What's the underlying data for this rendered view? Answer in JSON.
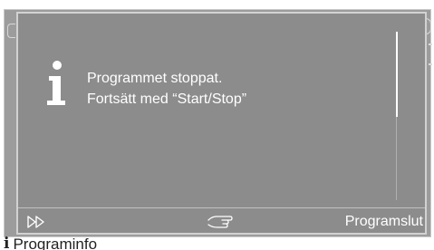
{
  "dialog": {
    "icon": "info-icon",
    "message_line1": "Programmet stoppat.",
    "message_line2": "Fortsätt med “Start/Stop”",
    "scroll_position": 0.5
  },
  "bottom_bar": {
    "skip_icon": "fast-forward-icon",
    "hand_icon": "pointing-hand-icon",
    "end_label": "Programslut"
  },
  "background": {
    "footer_label": "Programinfo",
    "footer_icon": "info-icon"
  },
  "colors": {
    "dialog_bg": "#8c8c8c",
    "text": "#ffffff",
    "border": "#d2d2d2"
  }
}
